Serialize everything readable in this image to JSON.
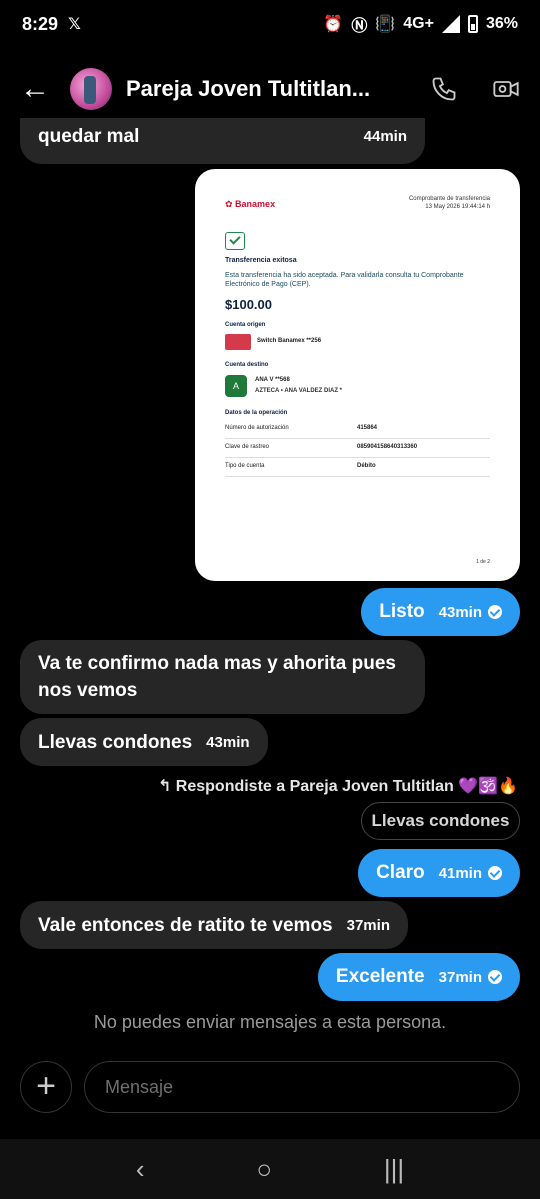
{
  "status_bar": {
    "time": "8:29",
    "app_icon": "x-logo-icon",
    "network": "4G+",
    "battery": "36%"
  },
  "header": {
    "contact_name": "Pareja Joven Tultitlan...",
    "icons": [
      "back-arrow-icon",
      "phone-icon",
      "video-icon"
    ]
  },
  "messages": [
    {
      "id": "m1",
      "direction": "in",
      "text": "quedar mal",
      "time": "44min"
    },
    {
      "id": "m2",
      "direction": "out",
      "text": "Listo",
      "time": "43min"
    },
    {
      "id": "m3",
      "direction": "in",
      "text": "Va te confirmo nada mas y ahorita pues nos vemos"
    },
    {
      "id": "m4",
      "direction": "in",
      "text": "Llevas condones",
      "time": "43min"
    },
    {
      "id": "m5",
      "direction": "out",
      "text": "Claro",
      "time": "41min"
    },
    {
      "id": "m6",
      "direction": "in",
      "text": "Vale entonces de ratito te vemos",
      "time": "37min"
    },
    {
      "id": "m7",
      "direction": "out",
      "text": "Excelente",
      "time": "37min"
    }
  ],
  "receipt": {
    "brand": "Banamex",
    "header_line1": "Comprobante de transferencia",
    "header_line2": "13 May 2026 19:44:14 h",
    "status_title": "Transferencia exitosa",
    "status_desc": "Esta transferencia ha sido aceptada. Para validarla consulta tu Comprobante Electrónico de Pago (CEP).",
    "amount": "$100.00",
    "origin_label": "Cuenta origen",
    "origin_account": "Switch Banamex **256",
    "dest_label": "Cuenta destino",
    "dest_initial": "A",
    "dest_name": "ANA V **568",
    "dest_bank": "AZTECA • ANA VALDEZ DIAZ *",
    "ops_label": "Datos de la operación",
    "rows": [
      {
        "label": "Número de autorización",
        "value": "415864"
      },
      {
        "label": "Clave de rastreo",
        "value": "085904158640313360"
      },
      {
        "label": "Tipo de cuenta",
        "value": "Débito"
      }
    ],
    "page": "1 de 2"
  },
  "reply": {
    "note": "↰ Respondiste a Pareja Joven Tultitlan 💜🕉️🔥",
    "quoted": "Llevas condones"
  },
  "notice": "No puedes enviar mensajes a esta persona.",
  "composer": {
    "placeholder": "Mensaje"
  }
}
